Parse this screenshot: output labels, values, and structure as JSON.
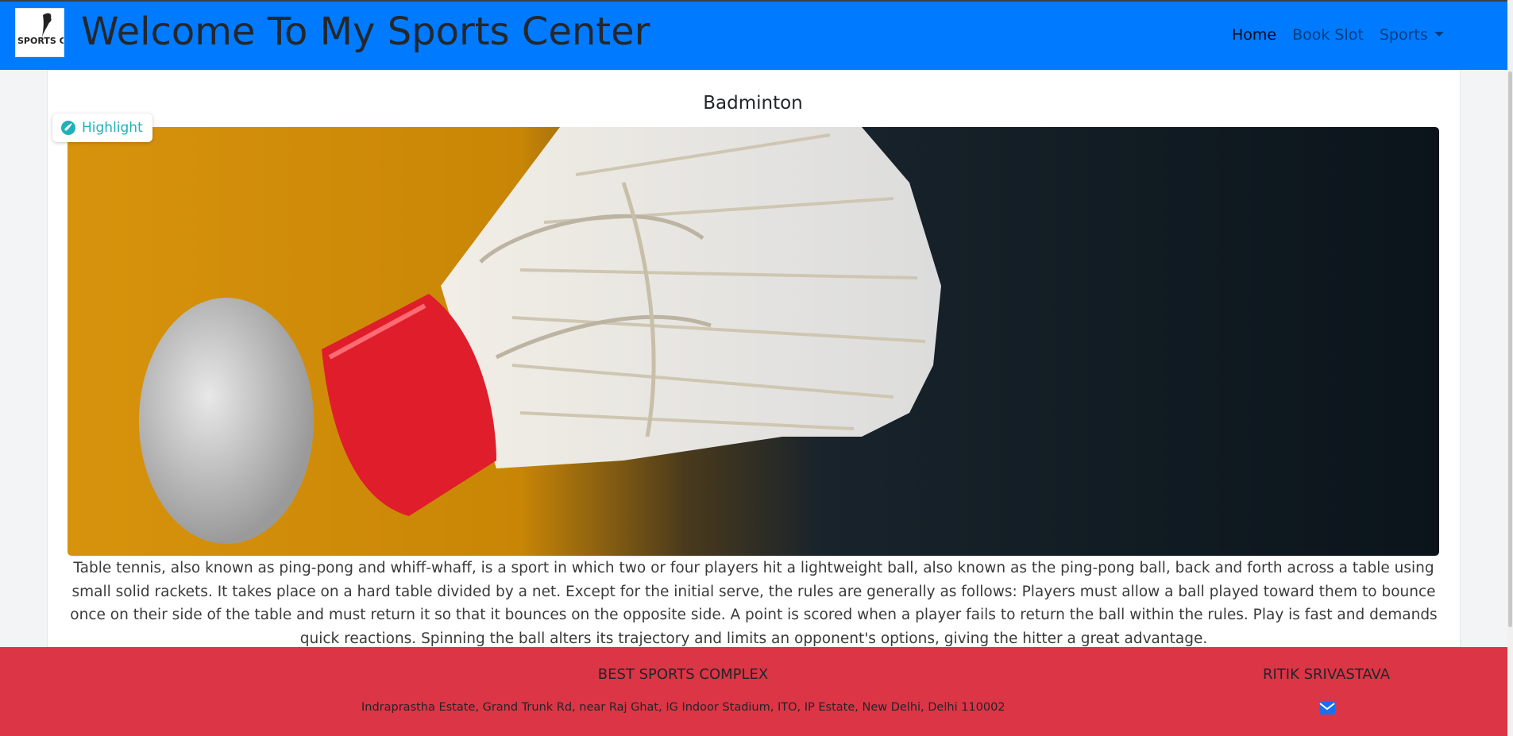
{
  "header": {
    "logo_alt": "SPORTS COMPLEX",
    "title": "Welcome To My Sports Center",
    "nav": [
      {
        "label": "Home",
        "active": true
      },
      {
        "label": "Book Slot",
        "active": false
      },
      {
        "label": "Sports",
        "active": false,
        "dropdown": true
      }
    ],
    "brand_color": "#007bff"
  },
  "main": {
    "heading": "Badminton",
    "highlight_label": "Highlight",
    "image_icon": "shuttlecock-photo",
    "description": "Table tennis, also known as ping-pong and whiff-whaff, is a sport in which two or four players hit a lightweight ball, also known as the ping-pong ball, back and forth across a table using small solid rackets. It takes place on a hard table divided by a net. Except for the initial serve, the rules are generally as follows: Players must allow a ball played toward them to bounce once on their side of the table and must return it so that it bounces on the opposite side. A point is scored when a player fails to return the ball within the rules. Play is fast and demands quick reactions. Spinning the ball alters its trajectory and limits an opponent's options, giving the hitter a great advantage."
  },
  "footer": {
    "org": "BEST SPORTS COMPLEX",
    "address": "Indraprastha Estate, Grand Trunk Rd, near Raj Ghat, IG Indoor Stadium, ITO, IP Estate, New Delhi, Delhi 110002",
    "author": "RITIK SRIVASTAVA",
    "contact_icon": "envelope-icon",
    "color": "#dc3545"
  }
}
